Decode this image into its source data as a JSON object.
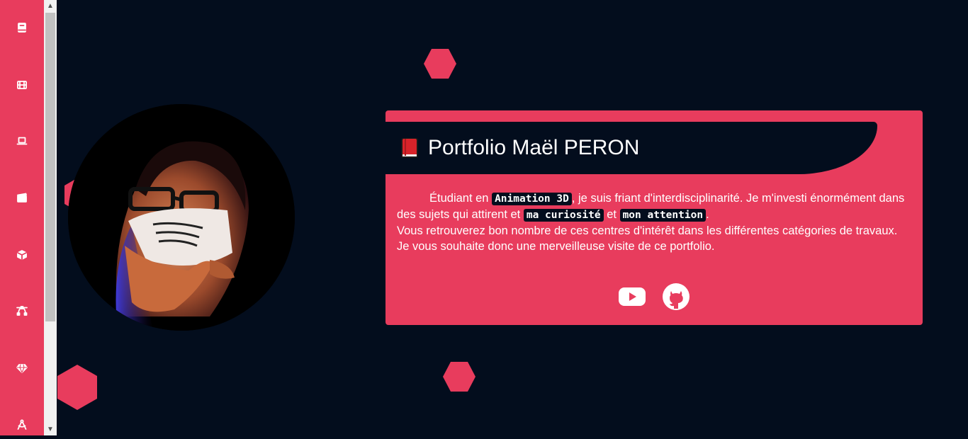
{
  "sidebar": {
    "items": [
      {
        "icon": "book-icon"
      },
      {
        "icon": "film-icon"
      },
      {
        "icon": "laptop-icon"
      },
      {
        "icon": "clapperboard-icon"
      },
      {
        "icon": "cube-icon"
      },
      {
        "icon": "bezier-curve-icon"
      },
      {
        "icon": "gem-icon"
      },
      {
        "icon": "compass-drafting-icon"
      }
    ]
  },
  "scrollbar": {
    "up": "▲",
    "down": "▼"
  },
  "card": {
    "title": "Portfolio Maël PERON",
    "intro_1": "Étudiant en ",
    "code_1": "Animation 3D",
    "intro_2": ", je suis friant d'interdisciplinarité. Je m'investi énormément dans des sujets qui attirent et ",
    "code_2": "ma curiosité",
    "intro_3": " et ",
    "code_3": "mon attention",
    "intro_4": ".",
    "line_2": "Vous retrouverez bon nombre de ces centres d'intérêt dans les différentes catégories de travaux.",
    "line_3": "Je vous souhaite donc une merveilleuse visite de ce portfolio."
  },
  "socials": [
    {
      "icon": "youtube-icon"
    },
    {
      "icon": "github-icon"
    }
  ],
  "colors": {
    "accent": "#e83c5d",
    "background": "#030d1d",
    "text": "#ffffff"
  }
}
